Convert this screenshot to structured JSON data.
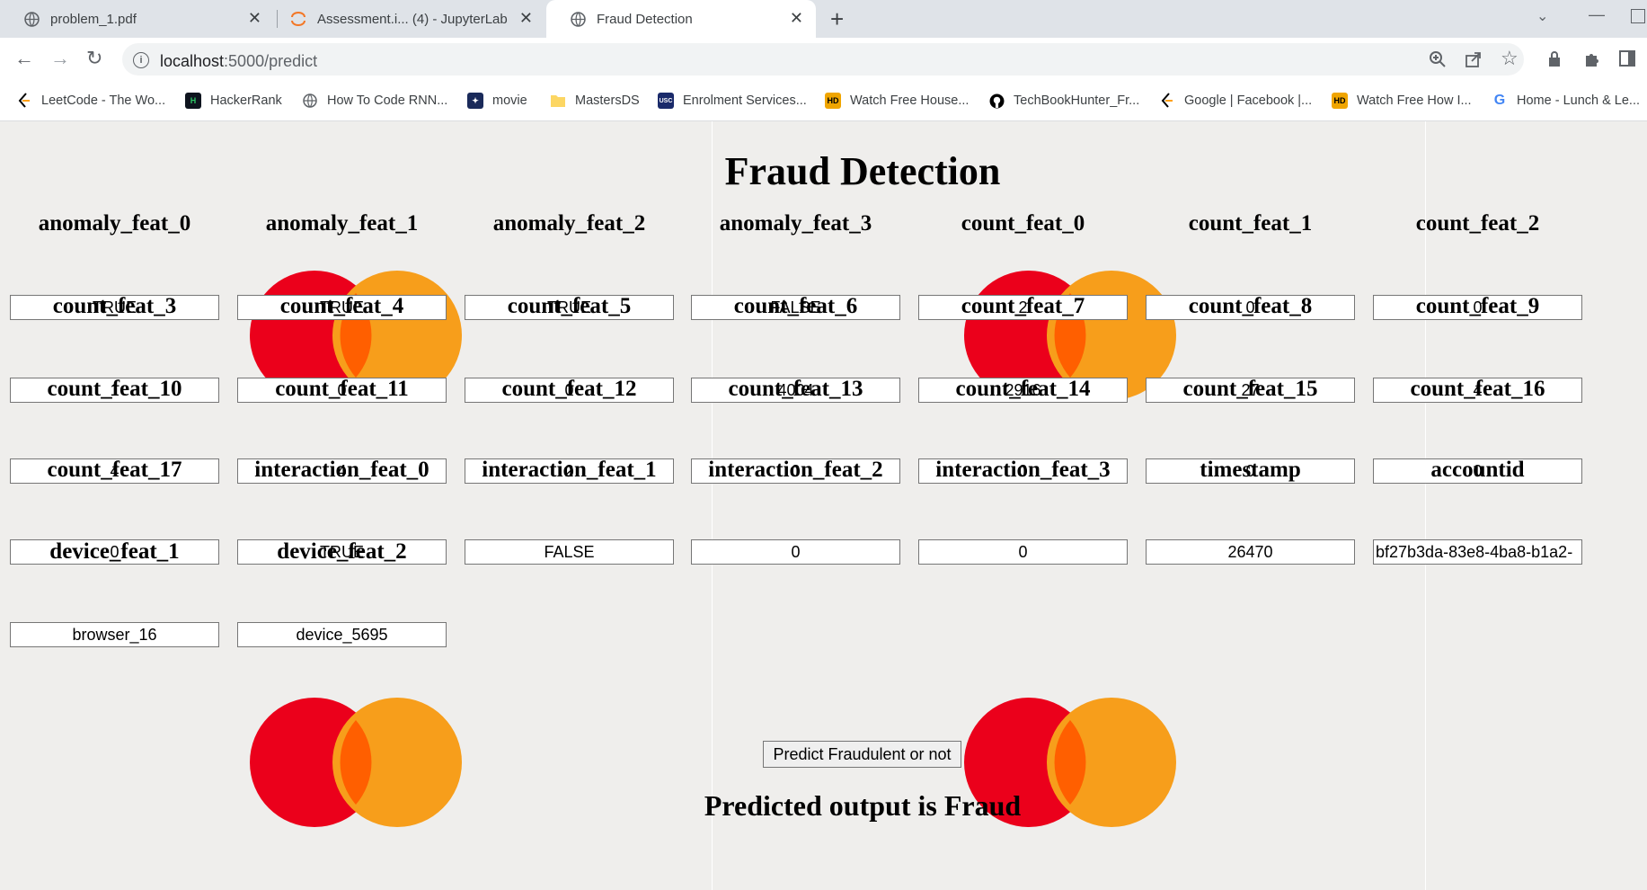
{
  "browser": {
    "tabs": [
      {
        "title": "problem_1.pdf"
      },
      {
        "title": "Assessment.i... (4) - JupyterLab"
      },
      {
        "title": "Fraud Detection"
      }
    ],
    "url": {
      "host": "localhost",
      "path": ":5000/predict"
    },
    "bookmarks": [
      {
        "label": "LeetCode - The Wo...",
        "icon": "leetcode-icon"
      },
      {
        "label": "HackerRank",
        "icon": "hackerrank-icon"
      },
      {
        "label": "How To Code RNN...",
        "icon": "globe-icon"
      },
      {
        "label": "movie",
        "icon": "movie-icon"
      },
      {
        "label": "MastersDS",
        "icon": "folder-icon"
      },
      {
        "label": "Enrolment Services...",
        "icon": "usc-icon"
      },
      {
        "label": "Watch Free House...",
        "icon": "hd-icon"
      },
      {
        "label": "TechBookHunter_Fr...",
        "icon": "github-icon"
      },
      {
        "label": "Google | Facebook |...",
        "icon": "leetcode-icon"
      },
      {
        "label": "Watch Free How I...",
        "icon": "hd-icon"
      },
      {
        "label": "Home - Lunch & Le...",
        "icon": "google-icon"
      }
    ]
  },
  "page": {
    "title": "Fraud Detection",
    "fields": [
      {
        "label": "anomaly_feat_0",
        "value": "TRUE"
      },
      {
        "label": "anomaly_feat_1",
        "value": "TRUE"
      },
      {
        "label": "anomaly_feat_2",
        "value": "TRUE"
      },
      {
        "label": "anomaly_feat_3",
        "value": "FALSE"
      },
      {
        "label": "count_feat_0",
        "value": "2"
      },
      {
        "label": "count_feat_1",
        "value": "0"
      },
      {
        "label": "count_feat_2",
        "value": "0"
      },
      {
        "label": "count_feat_3",
        "value": "1"
      },
      {
        "label": "count_feat_4",
        "value": "0"
      },
      {
        "label": "count_feat_5",
        "value": "0"
      },
      {
        "label": "count_feat_6",
        "value": "4004"
      },
      {
        "label": "count_feat_7",
        "value": "2916"
      },
      {
        "label": "count_feat_8",
        "value": "27"
      },
      {
        "label": "count_feat_9",
        "value": "4"
      },
      {
        "label": "count_feat_10",
        "value": "4"
      },
      {
        "label": "count_feat_11",
        "value": "4"
      },
      {
        "label": "count_feat_12",
        "value": "2"
      },
      {
        "label": "count_feat_13",
        "value": "0"
      },
      {
        "label": "count_feat_14",
        "value": "0"
      },
      {
        "label": "count_feat_15",
        "value": "0"
      },
      {
        "label": "count_feat_16",
        "value": "0"
      },
      {
        "label": "count_feat_17",
        "value": "0"
      },
      {
        "label": "interaction_feat_0",
        "value": "TRUE"
      },
      {
        "label": "interaction_feat_1",
        "value": "FALSE"
      },
      {
        "label": "interaction_feat_2",
        "value": "0"
      },
      {
        "label": "interaction_feat_3",
        "value": "0"
      },
      {
        "label": "timestamp",
        "value": "26470"
      },
      {
        "label": "accountid",
        "value": "bf27b3da-83e8-4ba8-b1a2-"
      },
      {
        "label": "device_feat_1",
        "value": "browser_16"
      },
      {
        "label": "device_feat_2",
        "value": "device_5695"
      }
    ],
    "predict_button_label": "Predict Fraudulent or not",
    "predicted_output": "Predicted output is Fraud",
    "colors": {
      "logo_red": "#eb001b",
      "logo_orange": "#f79e1b",
      "logo_overlap": "#ff5f00",
      "background": "#efeeec"
    }
  }
}
